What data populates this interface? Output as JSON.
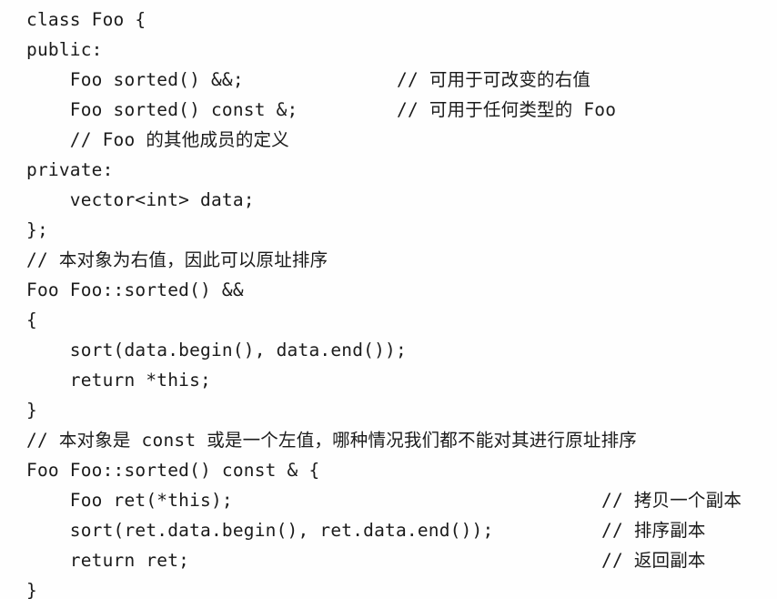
{
  "document": {
    "kind": "code-listing",
    "language": "C++",
    "background_color": "#fefefe",
    "text_color": "#1b1b1b",
    "comment_column_a": "436",
    "comment_column_b": "661"
  },
  "code": {
    "lines": [
      {
        "id": "line-1",
        "text": "class Foo {",
        "comment": ""
      },
      {
        "id": "line-2",
        "text": "public:",
        "comment": ""
      },
      {
        "id": "line-3",
        "text": "    Foo sorted() &&;",
        "comment": "// 可用于可改变的右值",
        "comment_col": "col-a"
      },
      {
        "id": "line-4",
        "text": "    Foo sorted() const &;",
        "comment": "// 可用于任何类型的 Foo",
        "comment_col": "col-a"
      },
      {
        "id": "line-5",
        "text": "    // Foo 的其他成员的定义",
        "comment": ""
      },
      {
        "id": "line-6",
        "text": "private:",
        "comment": ""
      },
      {
        "id": "line-7",
        "text": "    vector<int> data;",
        "comment": ""
      },
      {
        "id": "line-8",
        "text": "};",
        "comment": ""
      },
      {
        "id": "line-9",
        "text": "// 本对象为右值，因此可以原址排序",
        "comment": ""
      },
      {
        "id": "line-10",
        "text": "Foo Foo::sorted() &&",
        "comment": ""
      },
      {
        "id": "line-11",
        "text": "{",
        "comment": ""
      },
      {
        "id": "line-12",
        "text": "    sort(data.begin(), data.end());",
        "comment": ""
      },
      {
        "id": "line-13",
        "text": "    return *this;",
        "comment": ""
      },
      {
        "id": "line-14",
        "text": "}",
        "comment": ""
      },
      {
        "id": "line-15",
        "text": "// 本对象是 const 或是一个左值，哪种情况我们都不能对其进行原址排序",
        "comment": ""
      },
      {
        "id": "line-16",
        "text": "Foo Foo::sorted() const & {",
        "comment": ""
      },
      {
        "id": "line-17",
        "text": "    Foo ret(*this);",
        "comment": "// 拷贝一个副本",
        "comment_col": "col-b"
      },
      {
        "id": "line-18",
        "text": "    sort(ret.data.begin(), ret.data.end());",
        "comment": "// 排序副本",
        "comment_col": "col-b"
      },
      {
        "id": "line-19",
        "text": "    return ret;",
        "comment": "// 返回副本",
        "comment_col": "col-b"
      },
      {
        "id": "line-20",
        "text": "}",
        "comment": ""
      }
    ]
  }
}
